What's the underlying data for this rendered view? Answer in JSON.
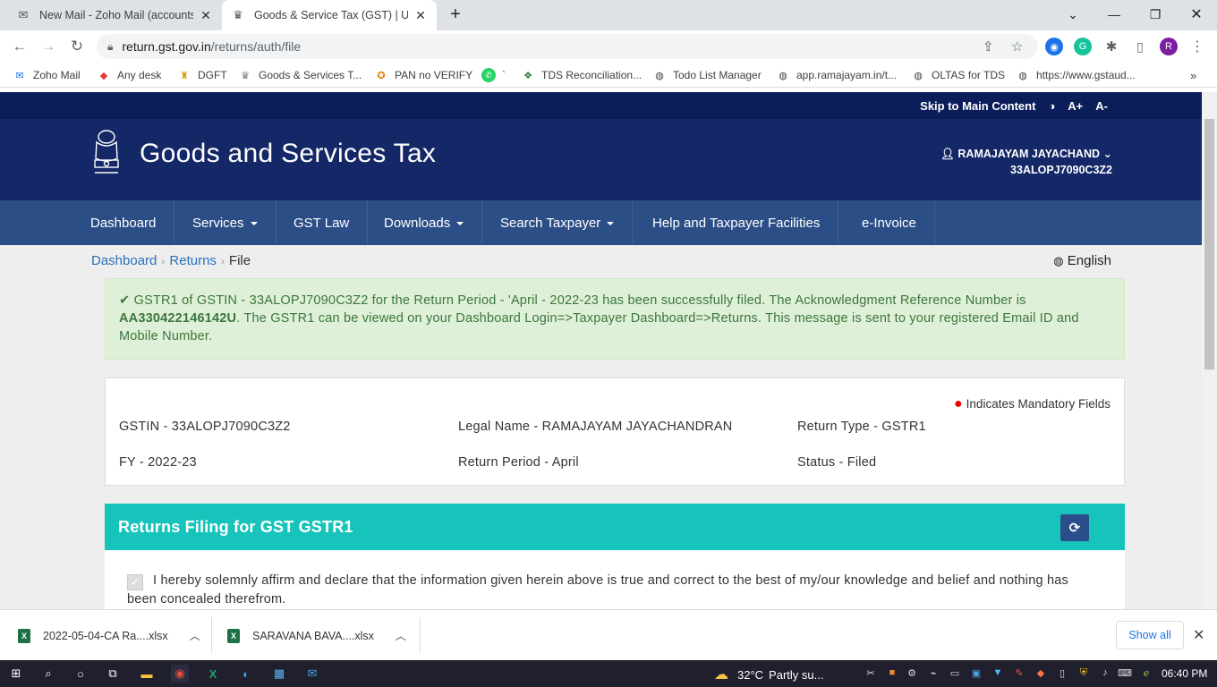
{
  "browser": {
    "tabs": [
      {
        "title": "New Mail - Zoho Mail (accounts@",
        "icon": "mail-icon",
        "active": false
      },
      {
        "title": "Goods & Service Tax (GST) | User",
        "icon": "gst-emblem-icon",
        "active": true
      }
    ],
    "new_tab": "+",
    "url_host": "return.gst.gov.in",
    "url_path": "/returns/auth/file",
    "profile_initial": "R"
  },
  "bookmarks": [
    {
      "label": "Zoho Mail",
      "icon": "zoho-icon"
    },
    {
      "label": "Any desk",
      "icon": "anydesk-icon"
    },
    {
      "label": "DGFT",
      "icon": "dgft-icon"
    },
    {
      "label": "Goods & Services T...",
      "icon": "gst-emblem-icon"
    },
    {
      "label": "PAN no VERIFY",
      "icon": "pan-icon"
    },
    {
      "label": "`",
      "icon": "whatsapp-icon"
    },
    {
      "label": "TDS Reconciliation...",
      "icon": "tds-icon"
    },
    {
      "label": "Todo List Manager",
      "icon": "globe-icon"
    },
    {
      "label": "app.ramajayam.in/t...",
      "icon": "globe-icon"
    },
    {
      "label": "OLTAS for TDS",
      "icon": "globe-icon"
    },
    {
      "label": "https://www.gstaud...",
      "icon": "globe-icon"
    }
  ],
  "site": {
    "skip_link": "Skip to Main Content",
    "contrast": "◑",
    "font_up": "A+",
    "font_down": "A-",
    "brand": "Goods and Services Tax",
    "user_name": "RAMAJAYAM JAYACHAND",
    "user_gstin": "33ALOPJ7090C3Z2",
    "menu": [
      "Dashboard",
      "Services",
      "GST Law",
      "Downloads",
      "Search Taxpayer",
      "Help and Taxpayer Facilities",
      "e-Invoice"
    ],
    "breadcrumb": {
      "home": "Dashboard",
      "section": "Returns",
      "current": "File"
    },
    "language": "English"
  },
  "alert": {
    "part1": "GSTR1 of GSTIN - 33ALOPJ7090C3Z2 for the Return Period - 'April - 2022-23 has been successfully filed. The Acknowledgment Reference Number is ",
    "ack_no": "AA330422146142U",
    "part2": ". The GSTR1 can be viewed on your Dashboard Login=>Taxpayer Dashboard=>Returns. This message is sent to your registered Email ID and Mobile Number."
  },
  "info": {
    "mandatory": "Indicates Mandatory Fields",
    "gstin": "GSTIN - 33ALOPJ7090C3Z2",
    "legal_name": "Legal Name - RAMAJAYAM JAYACHANDRAN",
    "return_type": "Return Type - GSTR1",
    "fy": "FY - 2022-23",
    "period": "Return Period - April",
    "status": "Status - Filed"
  },
  "filing": {
    "title": "Returns Filing for GST GSTR1",
    "declaration": "I hereby solemnly affirm and declare that the information given herein above is true and correct to the best of my/our knowledge and belief and nothing has been concealed therefrom."
  },
  "downloads": {
    "files": [
      "2022-05-04-CA Ra....xlsx",
      "SARAVANA BAVA....xlsx"
    ],
    "show_all": "Show all"
  },
  "taskbar": {
    "temperature": "32°C",
    "weather": "Partly su...",
    "time": "06:40 PM"
  }
}
